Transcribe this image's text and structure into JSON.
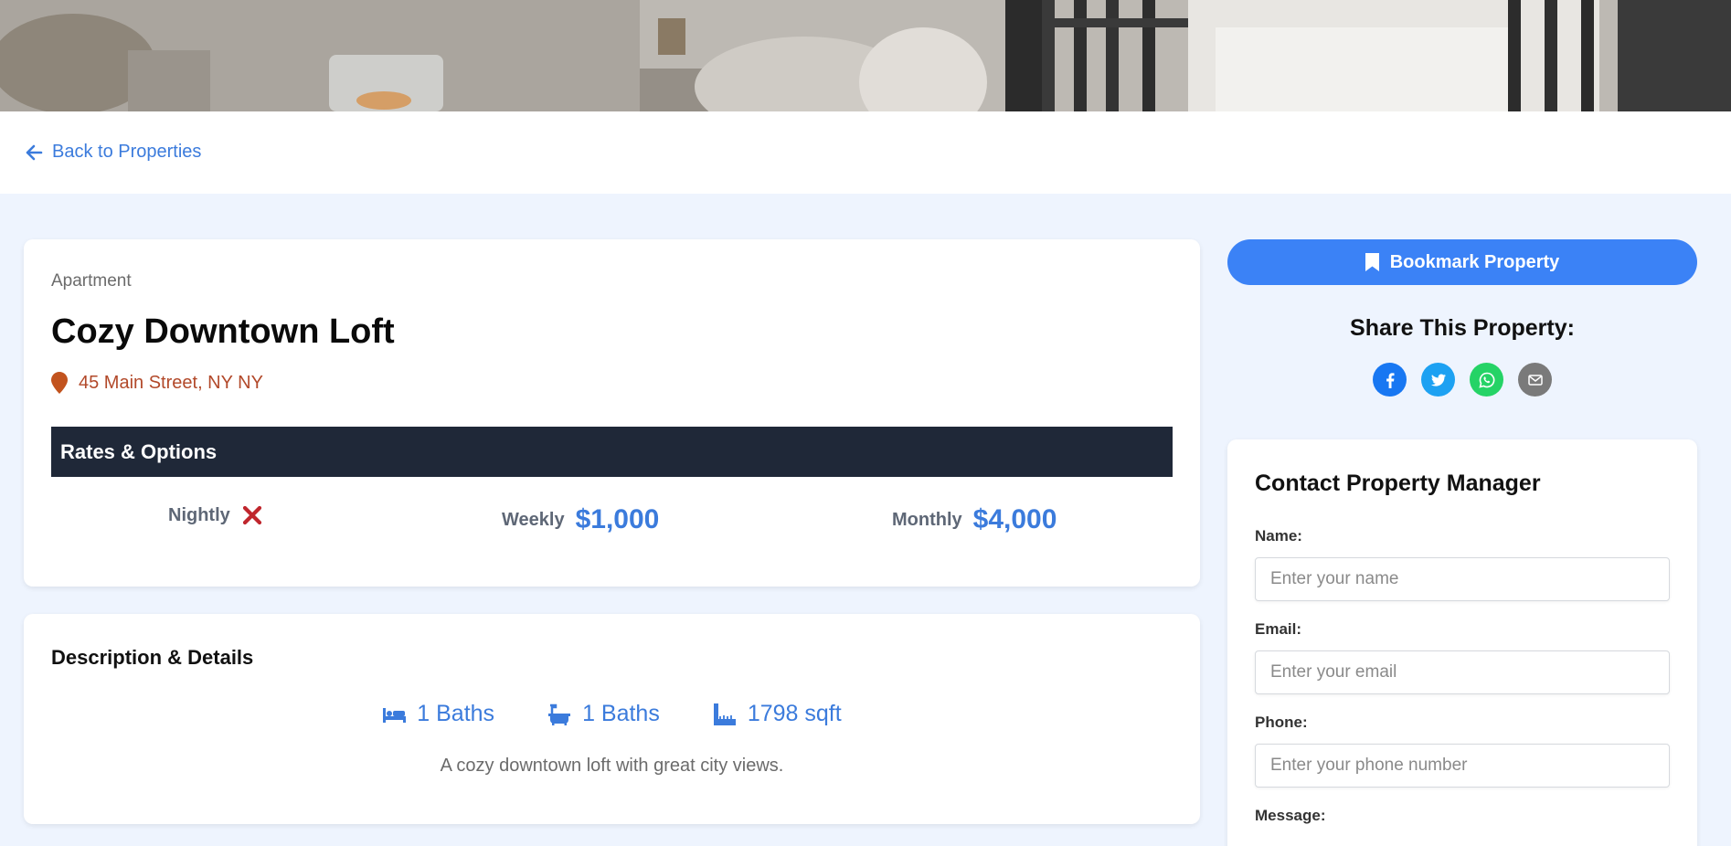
{
  "hero": {
    "alt": ""
  },
  "nav": {
    "back_label": "Back to Properties"
  },
  "property": {
    "type": "Apartment",
    "title": "Cozy Downtown Loft",
    "location": "45 Main Street, NY NY",
    "rates_header": "Rates & Options",
    "rates": {
      "nightly_label": "Nightly",
      "nightly_value": "unavailable",
      "weekly_label": "Weekly",
      "weekly_value": "$1,000",
      "monthly_label": "Monthly",
      "monthly_value": "$4,000"
    }
  },
  "details": {
    "title": "Description & Details",
    "beds": "1 Baths",
    "baths": "1 Baths",
    "area": "1798 sqft",
    "description": "A cozy downtown loft with great city views."
  },
  "sidebar": {
    "bookmark_label": "Bookmark Property",
    "share_title": "Share This Property:",
    "share_icons": [
      "facebook-icon",
      "twitter-icon",
      "whatsapp-icon",
      "email-icon"
    ]
  },
  "contact": {
    "title": "Contact Property Manager",
    "name_label": "Name:",
    "name_placeholder": "Enter your name",
    "email_label": "Email:",
    "email_placeholder": "Enter your email",
    "phone_label": "Phone:",
    "phone_placeholder": "Enter your phone number",
    "message_label": "Message:"
  },
  "colors": {
    "accent": "#3b82f6",
    "link": "#3b7bdc",
    "location": "#b2492a",
    "rates_header_bg": "#1f2838",
    "unavailable": "#c0262d",
    "page_bg": "#eef4fe"
  }
}
